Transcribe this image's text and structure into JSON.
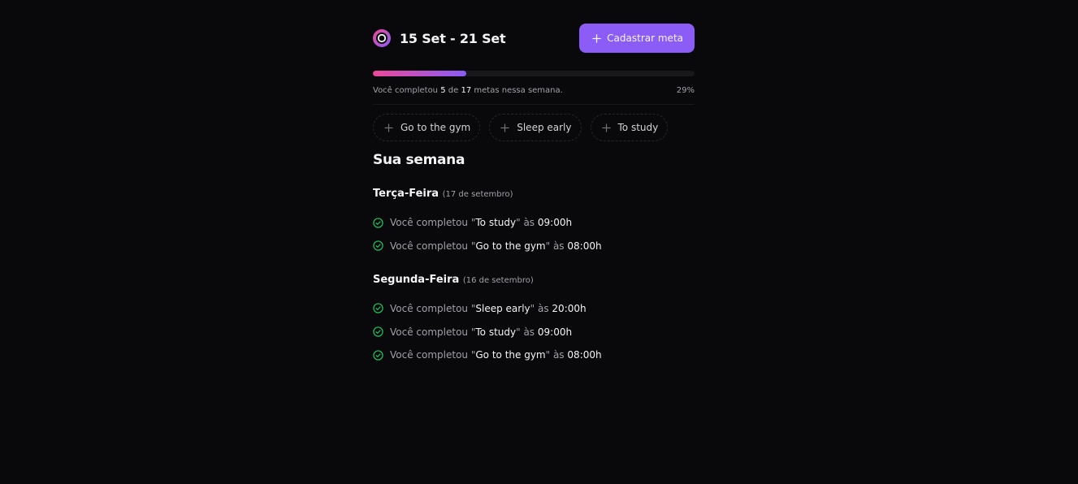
{
  "header": {
    "logo_icon": "in-orbit-logo-icon",
    "week_range": "15 Set - 21 Set",
    "create_goal_label": "Cadastrar meta"
  },
  "progress": {
    "prefix": "Você completou",
    "completed": "5",
    "of_word": "de",
    "total": "17",
    "suffix": "metas nessa semana.",
    "percent_label": "29%",
    "fraction": 0.29,
    "gradient_start": "#ec4899",
    "gradient_end": "#8b5cf6"
  },
  "pending_goals": [
    {
      "label": "Go to the gym"
    },
    {
      "label": "Sleep early"
    },
    {
      "label": "To study"
    }
  ],
  "summary": {
    "heading": "Sua semana",
    "completed_prefix": "Você completou",
    "at_word": "às",
    "days": [
      {
        "weekday": "Terça-Feira",
        "date": "(17 de setembro)",
        "completions": [
          {
            "goal": "To study",
            "time": "09:00h"
          },
          {
            "goal": "Go to the gym",
            "time": "08:00h"
          }
        ]
      },
      {
        "weekday": "Segunda-Feira",
        "date": "(16 de setembro)",
        "completions": [
          {
            "goal": "Sleep early",
            "time": "20:00h"
          },
          {
            "goal": "To study",
            "time": "09:00h"
          },
          {
            "goal": "Go to the gym",
            "time": "08:00h"
          }
        ]
      }
    ]
  },
  "colors": {
    "background": "#09090b",
    "accent": "#8b5cf6",
    "success": "#22c55e"
  }
}
